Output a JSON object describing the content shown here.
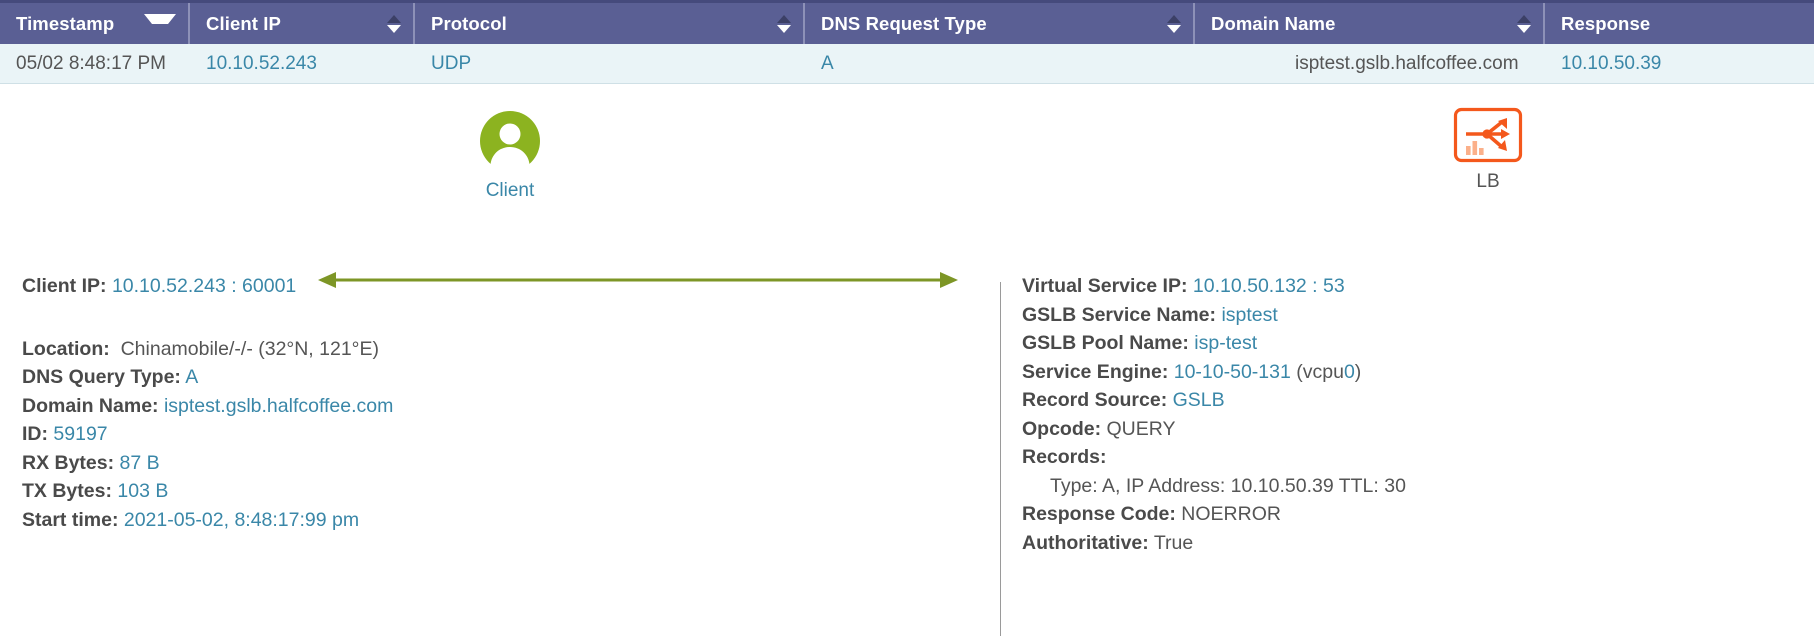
{
  "table": {
    "columns": [
      {
        "label": "Timestamp",
        "sort": "sort-desc-icon"
      },
      {
        "label": "Client IP",
        "sort": "sort-both-icon"
      },
      {
        "label": "Protocol",
        "sort": "sort-both-icon"
      },
      {
        "label": "DNS Request Type",
        "sort": "sort-both-icon"
      },
      {
        "label": "Domain Name",
        "sort": "sort-both-icon"
      },
      {
        "label": "Response",
        "sort": "none"
      }
    ],
    "row": {
      "timestamp": "05/02 8:48:17 PM",
      "client_ip": "10.10.52.243",
      "protocol": "UDP",
      "dns_request_type": "A",
      "domain_name": "isptest.gslb.halfcoffee.com",
      "response": "10.10.50.39"
    }
  },
  "diagram": {
    "client_node": {
      "label": "Client",
      "icon": "user-circle-icon",
      "color": "#8cb320"
    },
    "lb_node": {
      "label": "LB",
      "icon": "load-balancer-icon",
      "color": "#f4581c"
    },
    "arrow": {
      "icon": "double-headed-arrow-icon",
      "color": "#7d9626"
    }
  },
  "left_details": {
    "client_ip_key": "Client IP:",
    "client_ip_value": "10.10.52.243 : 60001",
    "location_key": "Location:",
    "location_value": "Chinamobile/-/- (32°N, 121°E)",
    "dns_query_type_key": "DNS Query Type:",
    "dns_query_type_value": "A",
    "domain_name_key": "Domain Name:",
    "domain_name_value": "isptest.gslb.halfcoffee.com",
    "id_key": "ID:",
    "id_value": "59197",
    "rx_bytes_key": "RX Bytes:",
    "rx_bytes_value": "87 B",
    "tx_bytes_key": "TX Bytes:",
    "tx_bytes_value": "103 B",
    "start_time_key": "Start time:",
    "start_time_value": "2021-05-02, 8:48:17:99 pm"
  },
  "right_details": {
    "virtual_service_ip_key": "Virtual Service IP:",
    "virtual_service_ip_value": "10.10.50.132 : 53",
    "gslb_service_name_key": "GSLB Service Name:",
    "gslb_service_name_value": "isptest",
    "gslb_pool_name_key": "GSLB Pool Name:",
    "gslb_pool_name_value": "isp-test",
    "service_engine_key": "Service Engine:",
    "service_engine_value": "10-10-50-131",
    "service_engine_vcpu_prefix": "(vcpu",
    "service_engine_vcpu_value": "0",
    "service_engine_vcpu_suffix": ")",
    "record_source_key": "Record Source:",
    "record_source_value": "GSLB",
    "opcode_key": "Opcode:",
    "opcode_value": "QUERY",
    "records_key": "Records:",
    "records_entry": "Type: A, IP Address: 10.10.50.39 TTL: 30",
    "response_code_key": "Response Code:",
    "response_code_value": "NOERROR",
    "authoritative_key": "Authoritative:",
    "authoritative_value": "True"
  }
}
